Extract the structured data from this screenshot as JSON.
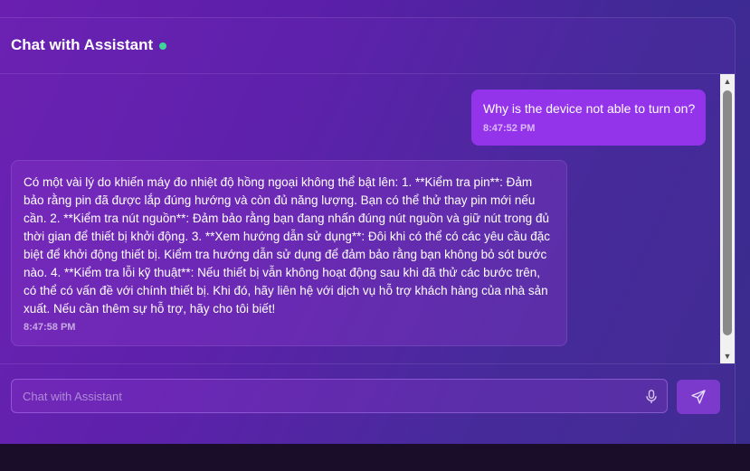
{
  "header": {
    "title": "Chat with Assistant",
    "status": "online"
  },
  "messages": [
    {
      "role": "user",
      "text": "Why is the device not able to turn on?",
      "time": "8:47:52 PM"
    },
    {
      "role": "assistant",
      "text": "Có một vài lý do khiến máy đo nhiệt độ hồng ngoại không thể bật lên: 1. **Kiểm tra pin**: Đảm bảo rằng pin đã được lắp đúng hướng và còn đủ năng lượng. Bạn có thể thử thay pin mới nếu cần. 2. **Kiểm tra nút nguồn**: Đảm bảo rằng bạn đang nhấn đúng nút nguồn và giữ nút trong đủ thời gian để thiết bị khởi động. 3. **Xem hướng dẫn sử dụng**: Đôi khi có thể có các yêu cầu đặc biệt để khởi động thiết bị. Kiểm tra hướng dẫn sử dụng để đảm bảo rằng bạn không bỏ sót bước nào. 4. **Kiểm tra lỗi kỹ thuật**: Nếu thiết bị vẫn không hoạt động sau khi đã thử các bước trên, có thể có vấn đề với chính thiết bị. Khi đó, hãy liên hệ với dịch vụ hỗ trợ khách hàng của nhà sản xuất. Nếu cần thêm sự hỗ trợ, hãy cho tôi biết!",
      "time": "8:47:58 PM"
    }
  ],
  "input": {
    "placeholder": "Chat with Assistant",
    "value": ""
  },
  "icons": {
    "mic": "microphone-icon",
    "send": "send-icon"
  },
  "colors": {
    "user_bubble": "#9333ea",
    "status_dot": "#3ed49a",
    "send_button": "#7c3acd"
  }
}
